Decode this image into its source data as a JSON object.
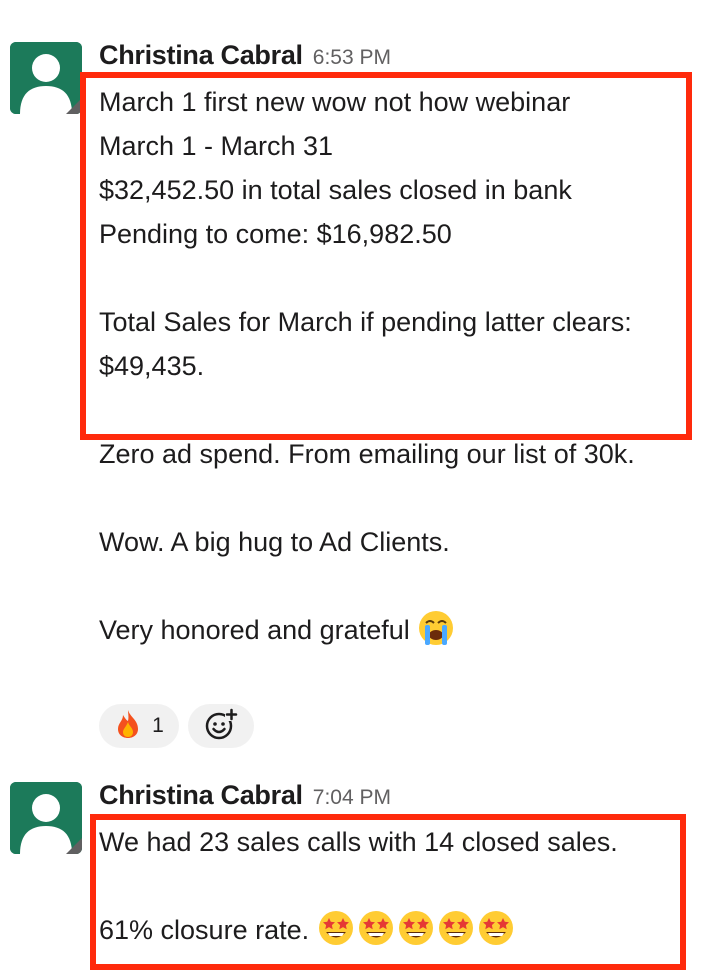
{
  "messages": [
    {
      "author": "Christina Cabral",
      "time": "6:53 PM",
      "lines": [
        "March 1 first new wow not how webinar",
        "March 1 - March 31",
        "$32,452.50 in total sales closed in bank",
        "Pending to come: $16,982.50",
        "Total Sales for March if pending latter clears:",
        "$49,435.",
        "Zero ad spend. From emailing our list of 30k.",
        "Wow. A big hug to Ad Clients.",
        "Very honored and grateful"
      ],
      "trailing_emoji": "loudly-crying-face-emoji",
      "reactions": [
        {
          "emoji": "fire-emoji",
          "count": "1"
        }
      ],
      "add_reaction_icon": "add-reaction-icon"
    },
    {
      "author": "Christina Cabral",
      "time": "7:04 PM",
      "lines": [
        "We had 23 sales calls with 14 closed sales.",
        "61% closure rate."
      ],
      "trailing_emoji": "star-struck-emoji",
      "trailing_emoji_count": 5
    }
  ],
  "colors": {
    "avatar_bg": "#1c7a5a",
    "highlight_border": "#ff2a0c",
    "reaction_bg": "#f1f1f1",
    "text": "#1d1c1d",
    "timestamp": "#616061"
  }
}
